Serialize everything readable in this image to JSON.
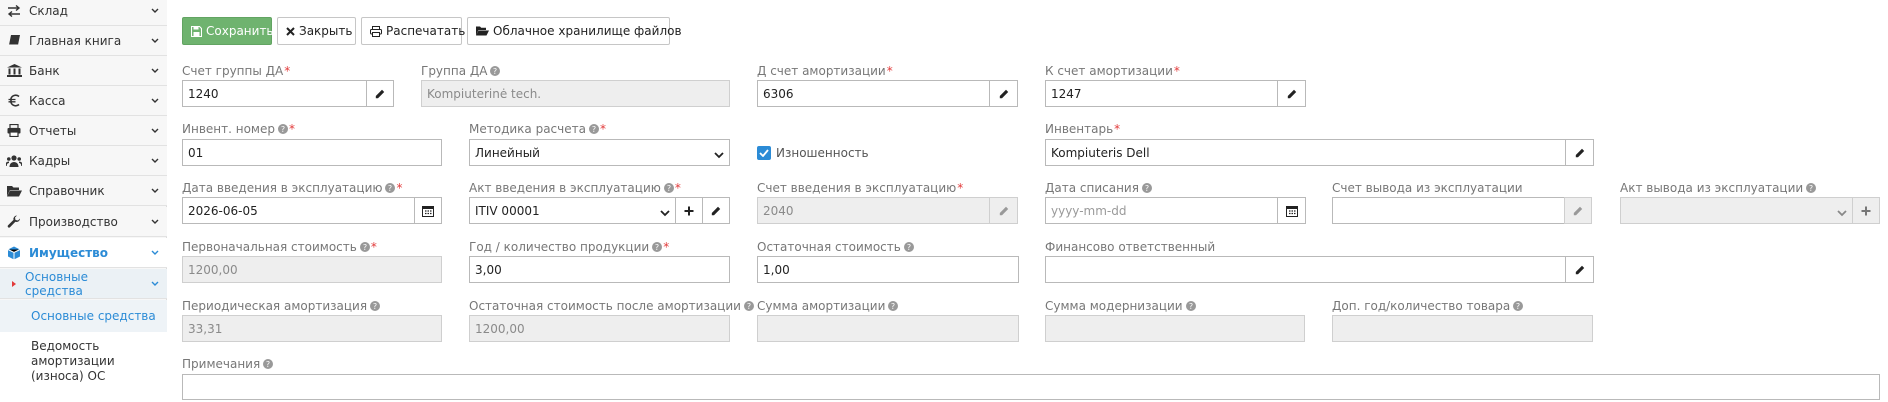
{
  "sidebar": {
    "items": [
      {
        "label": "Склад",
        "icon": "arrows-exchange-icon"
      },
      {
        "label": "Главная книга",
        "icon": "book-icon"
      },
      {
        "label": "Банк",
        "icon": "bank-icon"
      },
      {
        "label": "Касса",
        "icon": "euro-icon"
      },
      {
        "label": "Отчеты",
        "icon": "printer-icon"
      },
      {
        "label": "Кадры",
        "icon": "users-icon"
      },
      {
        "label": "Справочник",
        "icon": "folder-open-icon"
      },
      {
        "label": "Производство",
        "icon": "wrench-icon"
      },
      {
        "label": "Имущество",
        "icon": "cube-icon"
      }
    ],
    "submenu": {
      "label": "Основные средства"
    },
    "leaves": [
      {
        "label": "Основные средства"
      },
      {
        "label": "Ведомость амортизации (износа) ОС"
      }
    ]
  },
  "toolbar": {
    "save": "Сохранить",
    "close": "Закрыть",
    "print": "Распечатать",
    "cloud": "Облачное хранилище файлов"
  },
  "form": {
    "group_account": {
      "label": "Счет группы ДА",
      "value": "1240"
    },
    "group": {
      "label": "Группа ДА",
      "value": "Kompiuterinė tech."
    },
    "d_amort": {
      "label": "Д счет амортизации",
      "value": "6306"
    },
    "k_amort": {
      "label": "К счет амортизации",
      "value": "1247"
    },
    "inv_number": {
      "label": "Инвент. номер",
      "value": "01"
    },
    "method": {
      "label": "Методика расчета",
      "value": "Линейный"
    },
    "wear": {
      "label": "Изношенность",
      "checked": true
    },
    "inventory": {
      "label": "Инвентарь",
      "value": "Kompiuteris Dell"
    },
    "start_date": {
      "label": "Дата введения в эксплуатацию",
      "value": "2026-06-05"
    },
    "start_act": {
      "label": "Акт введения в эксплуатацию",
      "value": "ITIV 00001"
    },
    "start_account": {
      "label": "Счет введения в эксплуатацию",
      "value": "2040"
    },
    "writeoff_date": {
      "label": "Дата списания",
      "placeholder": "yyyy-mm-dd"
    },
    "out_account": {
      "label": "Счет вывода из эксплуатации",
      "value": ""
    },
    "out_act": {
      "label": "Акт вывода из эксплуатации",
      "value": ""
    },
    "initial_cost": {
      "label": "Первоначальная стоимость",
      "value": "1200,00"
    },
    "years": {
      "label": "Год / количество продукции",
      "value": "3,00"
    },
    "residual": {
      "label": "Остаточная стоимость",
      "value": "1,00"
    },
    "responsible": {
      "label": "Финансово ответственный",
      "value": ""
    },
    "periodic": {
      "label": "Периодическая амортизация",
      "value": "33,31"
    },
    "residual_after": {
      "label": "Остаточная стоимость после амортизации",
      "value": "1200,00"
    },
    "amort_sum": {
      "label": "Сумма амортизации",
      "value": ""
    },
    "modern_sum": {
      "label": "Сумма модернизации",
      "value": ""
    },
    "extra_years": {
      "label": "Доп. год/количество товара",
      "value": ""
    },
    "notes": {
      "label": "Примечания",
      "value": ""
    }
  },
  "colors": {
    "accent": "#2b8bd6",
    "primary_button": "#6fb36f",
    "required": "#e23a3a"
  }
}
